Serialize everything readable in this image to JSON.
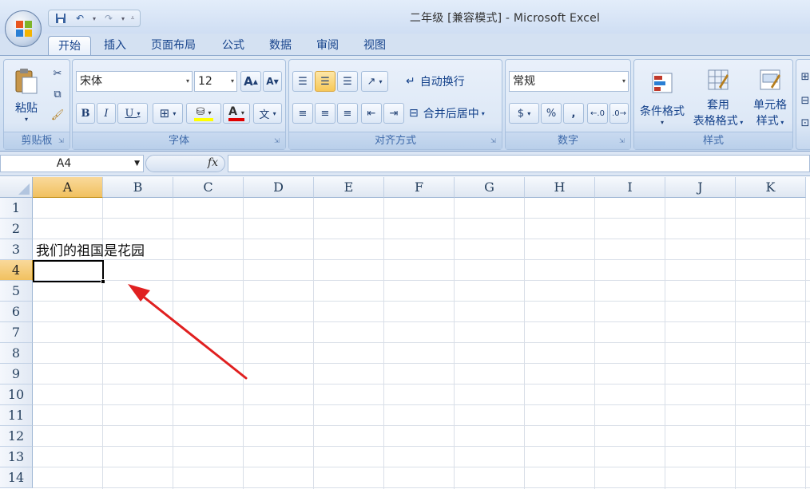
{
  "window": {
    "title": "二年级  [兼容模式] - Microsoft Excel"
  },
  "tabs": [
    "开始",
    "插入",
    "页面布局",
    "公式",
    "数据",
    "审阅",
    "视图"
  ],
  "ribbon": {
    "clipboard": {
      "label": "剪贴板",
      "paste": "粘贴"
    },
    "font": {
      "label": "字体",
      "family": "宋体",
      "size": "12",
      "bold": "B",
      "italic": "I",
      "underline": "U",
      "grow": "A",
      "shrink": "A",
      "phonetic": "文"
    },
    "alignment": {
      "label": "对齐方式",
      "wrap": "自动换行",
      "merge": "合并后居中"
    },
    "number": {
      "label": "数字",
      "format": "常规",
      "percent": "%",
      "comma": ","
    },
    "styles": {
      "label": "样式",
      "conditional": "条件格式",
      "table_line1": "套用",
      "table_line2": "表格格式",
      "cell_line1": "单元格",
      "cell_line2": "样式"
    }
  },
  "formula_bar": {
    "name_box": "A4",
    "fx": "fx",
    "formula": ""
  },
  "grid": {
    "columns": [
      "A",
      "B",
      "C",
      "D",
      "E",
      "F",
      "G",
      "H",
      "I",
      "J",
      "K"
    ],
    "rows": [
      "1",
      "2",
      "3",
      "4",
      "5",
      "6",
      "7",
      "8",
      "9",
      "10",
      "11",
      "12",
      "13",
      "14"
    ],
    "selected_column": "A",
    "selected_row": "4",
    "cells": {
      "A3": "我们的祖国是花园"
    }
  },
  "colors": {
    "arrow": "#e02020",
    "selection_header": "#f1c15f",
    "ribbon": "#d5e3f4"
  }
}
